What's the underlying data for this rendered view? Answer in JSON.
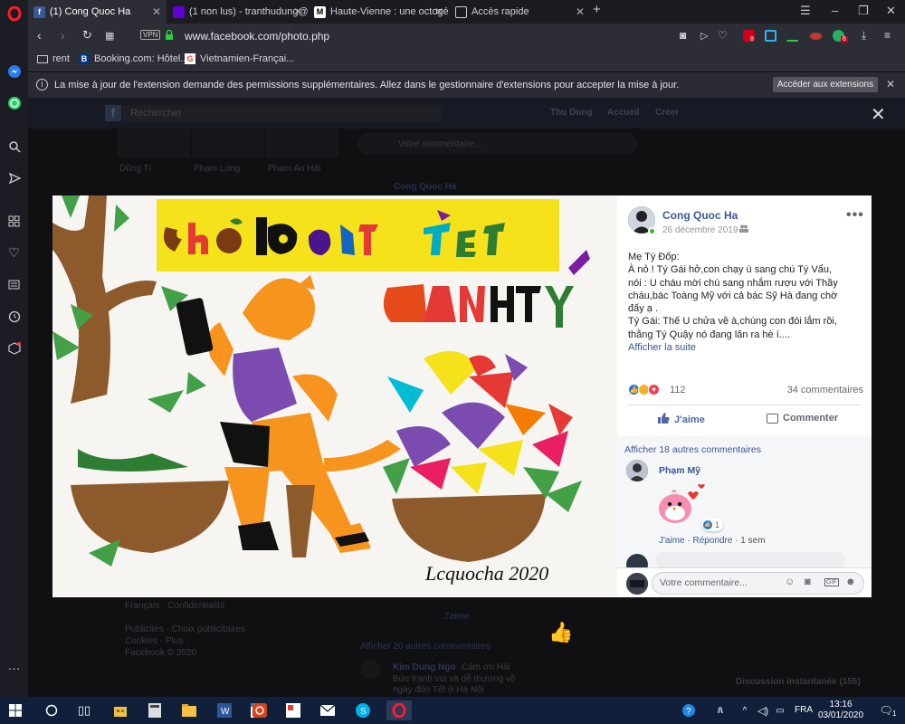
{
  "tabs": [
    {
      "label": "(1) Cong Quoc Ha",
      "icon": "facebook-icon",
      "active": true
    },
    {
      "label": "(1 non lus) - tranthudung@",
      "icon": "yahoo-mail-icon",
      "active": false
    },
    {
      "label": "Haute-Vienne : une octogé",
      "icon": "news-icon",
      "active": false
    },
    {
      "label": "Accès rapide",
      "icon": "speed-dial-icon",
      "active": false
    }
  ],
  "address_bar": {
    "vpn_label": "VPN",
    "url": "www.facebook.com/photo.php",
    "adblock_badge": "8",
    "extension_badge": "6"
  },
  "bookmarks": [
    "rent",
    "Booking.com: Hôtel...",
    "Vietnamien-Françai..."
  ],
  "extension_notice": {
    "message": "La mise à jour de l'extension demande des permissions supplémentaires. Allez dans le gestionnaire d'extensions pour accepter la mise à jour.",
    "button_label": "Accéder aux extensions"
  },
  "facebook_bg": {
    "search_placeholder": "Rechercher",
    "user_name": "Thu Dung",
    "home_label": "Accueil",
    "create_label": "Créer",
    "friends": [
      "Dũng Tí",
      "Phạm Long",
      "Phạm An Hải"
    ],
    "write_comment": "Votre commentaire...",
    "post_author": "Cong Quoc Ha",
    "footer_links": [
      "Français · Confidentialité",
      "Publicités · Choix publicitaires",
      "Cookies · Plus ·",
      "Facebook © 2020"
    ],
    "like_label": "J'aime",
    "more_comments": "Afficher 20 autres commentaires",
    "bg_commenter": "Kim Dung Ngo",
    "bg_comment": "Cảm ơn Hải",
    "bg_comment_2": "Bức tranh vui và dễ thương về",
    "bg_comment_3": "ngày đón Tết ở Hà Nội",
    "chat_label": "Discussion instantanée (155)"
  },
  "post": {
    "author": "Cong Quoc Ha",
    "date": "26 décembre 2019",
    "body_lines": [
      "Mẹ Tý Đốp:",
      "À nỏ ! Tý Gái hở,con chạy ù sang chú Tý Vẩu,",
      "nói : U cháu mời chú sang nhắm rượu với Thầy",
      "cháu,bác Toàng Mỹ với cả bác Sỹ Hà đang chờ",
      "đấy ạ .",
      "Tý Gái: Thế U chửa về à,chúng con đói lắm rồi,",
      "thằng Tý Quậy nó đang lăn ra hè í...."
    ],
    "see_more": "Afficher la suite",
    "reaction_count": "112",
    "comments_count": "34 commentaires",
    "like_label": "J'aime",
    "comment_label": "Commenter",
    "more_comments": "Afficher 18 autres commentaires",
    "comment": {
      "author": "Phạm Mỹ",
      "like_count": "1",
      "like_action": "J'aime",
      "reply_action": "Répondre",
      "time": "1 sem"
    },
    "comment_placeholder": "Votre commentaire..."
  },
  "artwork": {
    "title_text": "chợ hoa tết",
    "subtitle_text": "canh tý",
    "signature": "Lcquocha 2020"
  },
  "taskbar": {
    "language": "FRA",
    "time": "13:16",
    "date": "03/01/2020",
    "notification_count": "1"
  },
  "colors": {
    "facebook_blue": "#385898",
    "opera_red": "#ff1b2d",
    "taskbar": "#101f3a"
  }
}
